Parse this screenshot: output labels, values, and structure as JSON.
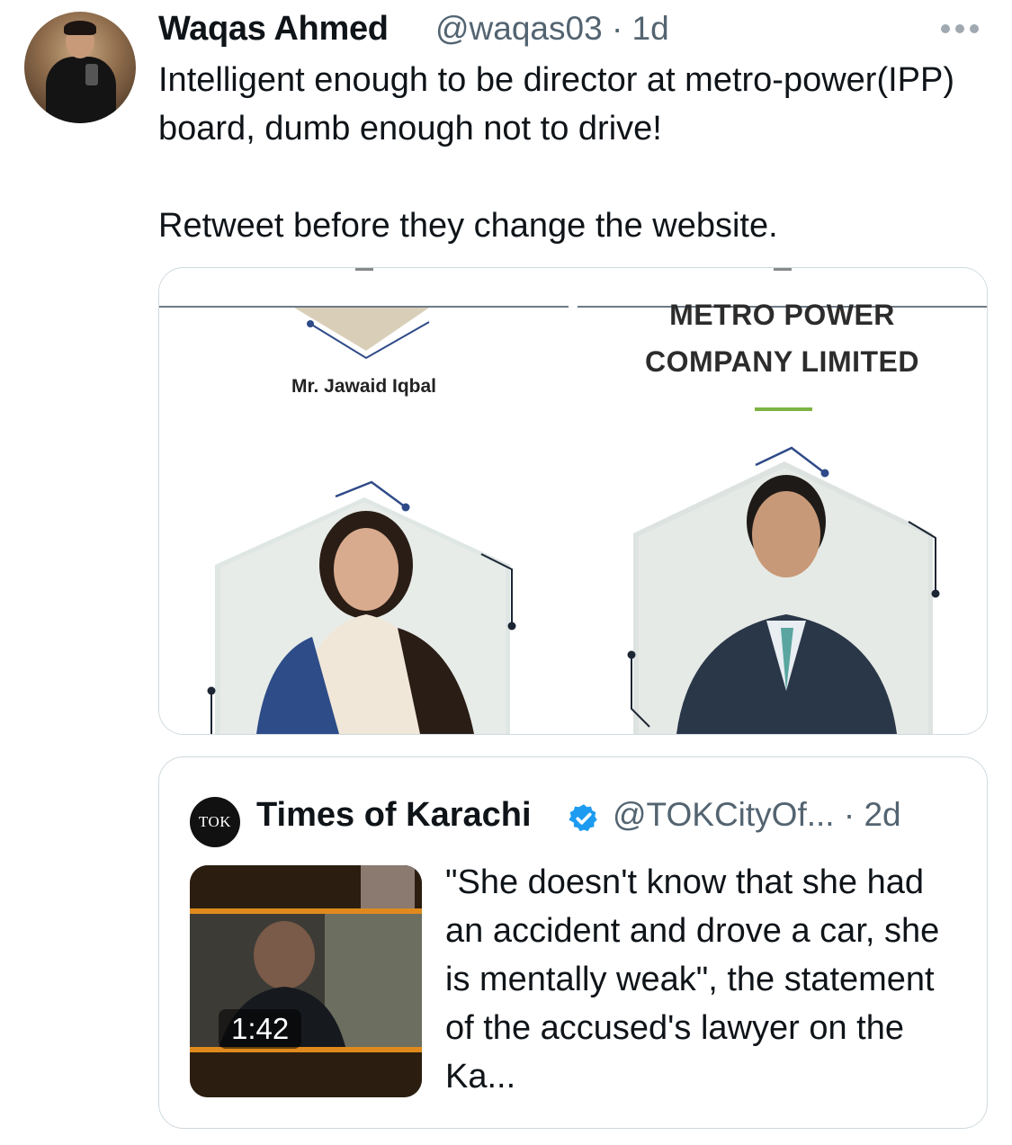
{
  "tweet": {
    "author_name": "Waqas Ahmed",
    "handle_time": "@waqas03 · 1d",
    "text_paragraphs": [
      "Intelligent enough to be director at metro-power(IPP) board, dumb enough not to drive!",
      "Retweet before they change the website."
    ]
  },
  "media": {
    "left_caption": "Mr. Jawaid Iqbal",
    "right_line1": "METRO POWER",
    "right_line2": "COMPANY LIMITED"
  },
  "quoted_tweet": {
    "avatar_text": "TOK",
    "author_name": "Times of Karachi",
    "handle_time": "@TOKCityOf... · 2d",
    "video_duration": "1:42",
    "text": "\"She doesn't know that she had an accident and drove a car, she is mentally weak\", the statement of the accused's lawyer on the Ka..."
  },
  "colors": {
    "text": "#0f1419",
    "secondary": "#536471",
    "border": "#cfd9de",
    "verified": "#1d9bf0",
    "accent_green": "#7cb342"
  },
  "icons": {
    "more": "more-dots-icon",
    "verified": "verified-badge-icon"
  }
}
